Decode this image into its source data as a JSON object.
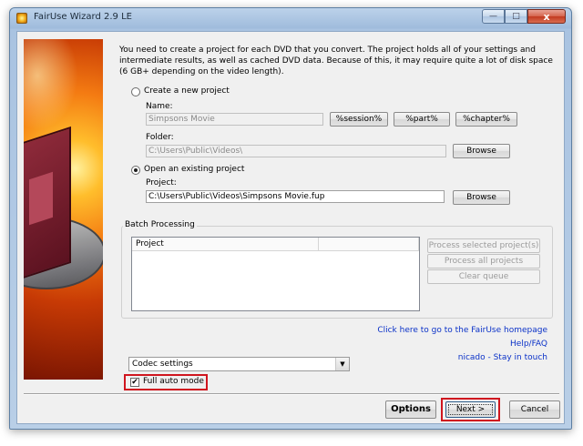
{
  "window": {
    "title": "FairUse Wizard 2.9 LE",
    "controls": {
      "minimize": "—",
      "maximize": "□",
      "close": "x"
    }
  },
  "intro_text": "You need to create a project for each DVD that you convert. The project holds all of your settings and intermediate results, as well as cached DVD data. Because of this, it may require quite a lot of disk space (6 GB+ depending on the video length).",
  "new_project": {
    "radio_label": "Create a new project",
    "selected": false,
    "name_label": "Name:",
    "name_value": "Simpsons Movie",
    "token_buttons": [
      "%session%",
      "%part%",
      "%chapter%"
    ],
    "folder_label": "Folder:",
    "folder_value": "C:\\Users\\Public\\Videos\\",
    "browse_label": "Browse"
  },
  "existing_project": {
    "radio_label": "Open an existing project",
    "selected": true,
    "project_label": "Project:",
    "project_value": "C:\\Users\\Public\\Videos\\Simpsons Movie.fup",
    "browse_label": "Browse"
  },
  "batch": {
    "group_title": "Batch Processing",
    "columns": [
      "Project",
      ""
    ],
    "rows": [],
    "buttons": [
      "Process selected project(s)",
      "Process all projects",
      "Clear queue"
    ]
  },
  "links": {
    "homepage": "Click here to go to the FairUse homepage",
    "help": "Help/FAQ",
    "contact": "nicado - Stay in touch"
  },
  "codec_select": {
    "selected": "Codec settings"
  },
  "full_auto": {
    "label": "Full auto mode",
    "checked": true,
    "check_glyph": "✔"
  },
  "footer": {
    "options_label": "Options",
    "next_label": "Next >",
    "cancel_label": "Cancel"
  },
  "colors": {
    "highlight": "#d0161f",
    "link": "#0b32c8"
  }
}
